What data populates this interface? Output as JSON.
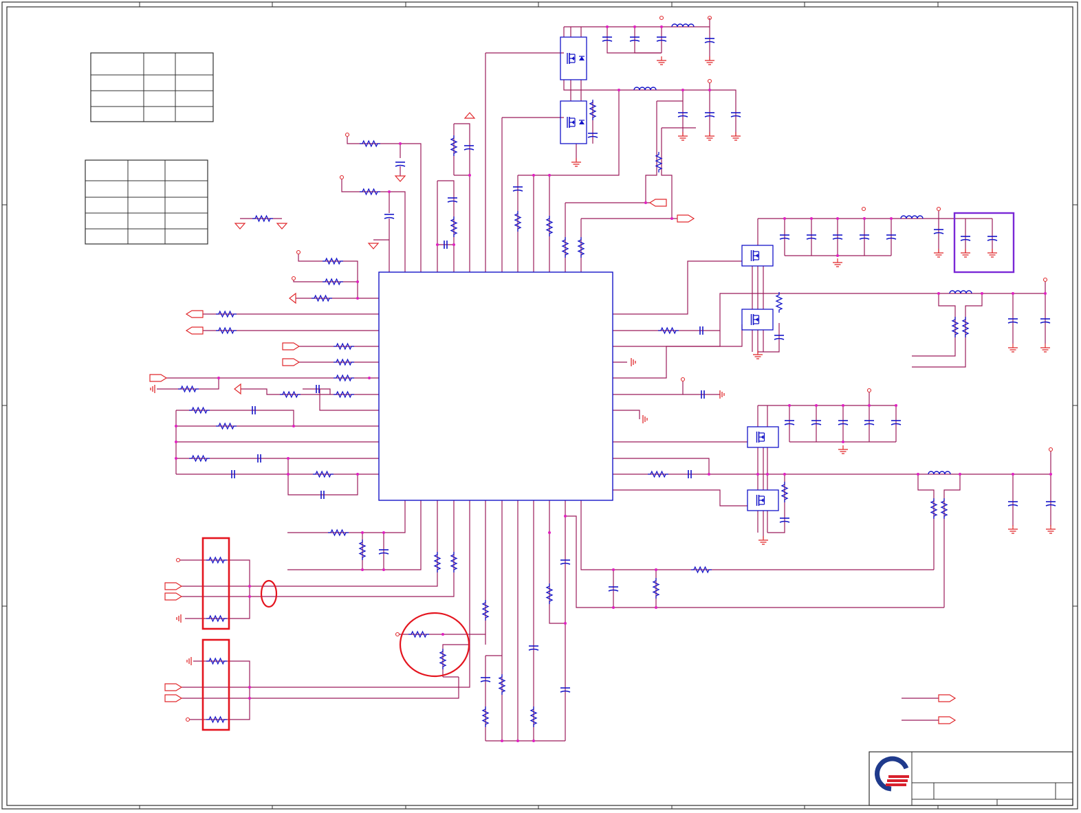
{
  "colors": {
    "wire": "#9b1b5a",
    "part": "#1414c8",
    "power": "#e0282c",
    "highlight_red": "#e4141e",
    "highlight_purple": "#7a28d6",
    "junction": "#e020c0",
    "frame": "#303030",
    "logo_blue": "#1f3a8c",
    "logo_red": "#d8202c"
  },
  "icons": {
    "logo": "company-logo-icon",
    "resistor": "resistor-icon",
    "capacitor": "capacitor-icon",
    "inductor": "inductor-icon",
    "mosfet": "mosfet-icon",
    "ground": "ground-icon",
    "power_port": "power-port-icon",
    "net_flag": "net-flag-icon"
  }
}
